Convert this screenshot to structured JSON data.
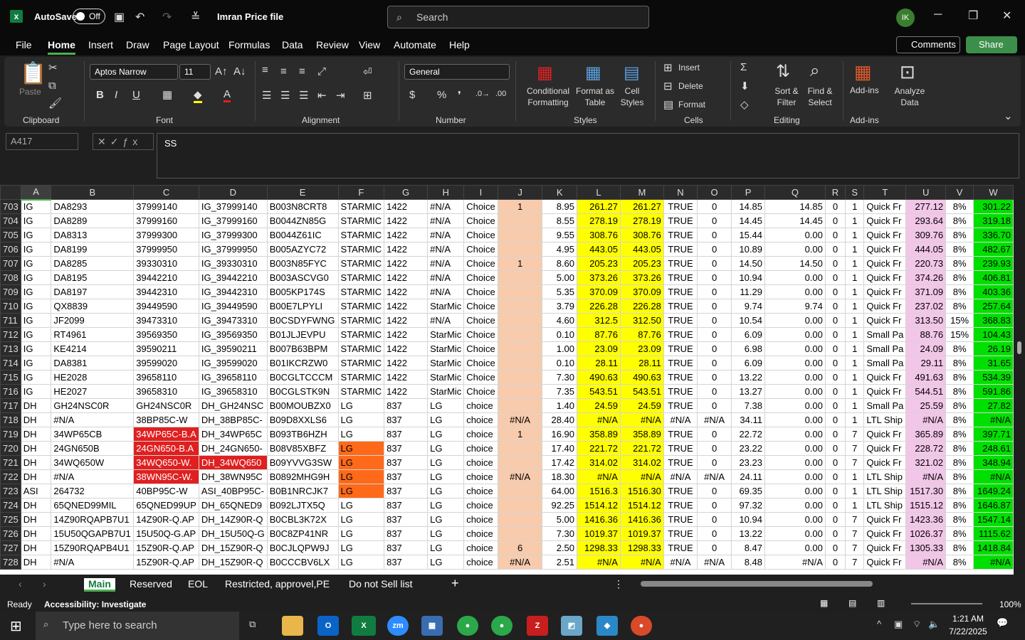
{
  "titlebar": {
    "autosave_label": "AutoSave",
    "autosave_state": "Off",
    "filename": "Imran Price file",
    "search_placeholder": "Search",
    "avatar_initials": "IK"
  },
  "menu": [
    "File",
    "Home",
    "Insert",
    "Draw",
    "Page Layout",
    "Formulas",
    "Data",
    "Review",
    "View",
    "Automate",
    "Help"
  ],
  "buttons": {
    "comments": "Comments",
    "share": "Share"
  },
  "ribbon": {
    "paste": "Paste",
    "clipboard": "Clipboard",
    "font_name": "Aptos Narrow",
    "font_size": "11",
    "font": "Font",
    "alignment": "Alignment",
    "number_format": "General",
    "number": "Number",
    "conditional_formatting": "Conditional Formatting",
    "format_as_table": "Format as Table",
    "cell_styles": "Cell Styles",
    "styles": "Styles",
    "insert": "Insert",
    "delete": "Delete",
    "format": "Format",
    "cells": "Cells",
    "sort_filter": "Sort & Filter",
    "find_select": "Find & Select",
    "editing": "Editing",
    "addins": "Add-ins",
    "addins_group": "Add-ins",
    "analyze_data": "Analyze Data"
  },
  "formula_bar": {
    "name_box": "A417",
    "formula": "SS"
  },
  "columns": [
    "A",
    "B",
    "C",
    "D",
    "E",
    "F",
    "G",
    "H",
    "I",
    "J",
    "K",
    "L",
    "M",
    "N",
    "O",
    "P",
    "Q",
    "R",
    "S",
    "T",
    "U",
    "V",
    "W"
  ],
  "rows": [
    [
      "703",
      "IG",
      "DA8293",
      "37999140",
      "IG_37999140",
      "B003N8CRT8",
      "STARMIC",
      "1422",
      "#N/A",
      "Choice",
      "1",
      "8.95",
      "261.27",
      "261.27",
      "TRUE",
      "0",
      "14.85",
      "14.85",
      "0",
      "1",
      "Quick Fr",
      "277.12",
      "8%",
      "301.22"
    ],
    [
      "704",
      "IG",
      "DA8289",
      "37999160",
      "IG_37999160",
      "B0044ZN85G",
      "STARMIC",
      "1422",
      "#N/A",
      "Choice",
      "",
      "8.55",
      "278.19",
      "278.19",
      "TRUE",
      "0",
      "14.45",
      "14.45",
      "0",
      "1",
      "Quick Fr",
      "293.64",
      "8%",
      "319.18"
    ],
    [
      "705",
      "IG",
      "DA8313",
      "37999300",
      "IG_37999300",
      "B0044Z61IC",
      "STARMIC",
      "1422",
      "#N/A",
      "Choice",
      "",
      "9.55",
      "308.76",
      "308.76",
      "TRUE",
      "0",
      "15.44",
      "0.00",
      "0",
      "1",
      "Quick Fr",
      "309.76",
      "8%",
      "336.70"
    ],
    [
      "706",
      "IG",
      "DA8199",
      "37999950",
      "IG_37999950",
      "B005AZYC72",
      "STARMIC",
      "1422",
      "#N/A",
      "Choice",
      "",
      "4.95",
      "443.05",
      "443.05",
      "TRUE",
      "0",
      "10.89",
      "0.00",
      "0",
      "1",
      "Quick Fr",
      "444.05",
      "8%",
      "482.67"
    ],
    [
      "707",
      "IG",
      "DA8285",
      "39330310",
      "IG_39330310",
      "B003N85FYC",
      "STARMIC",
      "1422",
      "#N/A",
      "Choice",
      "1",
      "8.60",
      "205.23",
      "205.23",
      "TRUE",
      "0",
      "14.50",
      "14.50",
      "0",
      "1",
      "Quick Fr",
      "220.73",
      "8%",
      "239.93"
    ],
    [
      "708",
      "IG",
      "DA8195",
      "39442210",
      "IG_39442210",
      "B003ASCVG0",
      "STARMIC",
      "1422",
      "#N/A",
      "Choice",
      "",
      "5.00",
      "373.26",
      "373.26",
      "TRUE",
      "0",
      "10.94",
      "0.00",
      "0",
      "1",
      "Quick Fr",
      "374.26",
      "8%",
      "406.81"
    ],
    [
      "709",
      "IG",
      "DA8197",
      "39442310",
      "IG_39442310",
      "B005KP174S",
      "STARMIC",
      "1422",
      "#N/A",
      "Choice",
      "",
      "5.35",
      "370.09",
      "370.09",
      "TRUE",
      "0",
      "11.29",
      "0.00",
      "0",
      "1",
      "Quick Fr",
      "371.09",
      "8%",
      "403.36"
    ],
    [
      "710",
      "IG",
      "QX8839",
      "39449590",
      "IG_39449590",
      "B00E7LPYLI",
      "STARMIC",
      "1422",
      "StarMic",
      "Choice",
      "",
      "3.79",
      "226.28",
      "226.28",
      "TRUE",
      "0",
      "9.74",
      "9.74",
      "0",
      "1",
      "Quick Fr",
      "237.02",
      "8%",
      "257.64"
    ],
    [
      "711",
      "IG",
      "JF2099",
      "39473310",
      "IG_39473310",
      "B0CSDYFWNG",
      "STARMIC",
      "1422",
      "#N/A",
      "Choice",
      "",
      "4.60",
      "312.5",
      "312.50",
      "TRUE",
      "0",
      "10.54",
      "0.00",
      "0",
      "1",
      "Quick Fr",
      "313.50",
      "15%",
      "368.83"
    ],
    [
      "712",
      "IG",
      "RT4961",
      "39569350",
      "IG_39569350",
      "B01JLJEVPU",
      "STARMIC",
      "1422",
      "StarMic",
      "Choice",
      "",
      "0.10",
      "87.76",
      "87.76",
      "TRUE",
      "0",
      "6.09",
      "0.00",
      "0",
      "1",
      "Small Pa",
      "88.76",
      "15%",
      "104.43"
    ],
    [
      "713",
      "IG",
      "KE4214",
      "39590211",
      "IG_39590211",
      "B007B63BPM",
      "STARMIC",
      "1422",
      "StarMic",
      "Choice",
      "",
      "1.00",
      "23.09",
      "23.09",
      "TRUE",
      "0",
      "6.98",
      "0.00",
      "0",
      "1",
      "Small Pa",
      "24.09",
      "8%",
      "26.19"
    ],
    [
      "714",
      "IG",
      "DA8381",
      "39599020",
      "IG_39599020",
      "B01IKCRZW0",
      "STARMIC",
      "1422",
      "StarMic",
      "Choice",
      "",
      "0.10",
      "28.11",
      "28.11",
      "TRUE",
      "0",
      "6.09",
      "0.00",
      "0",
      "1",
      "Small Pa",
      "29.11",
      "8%",
      "31.65"
    ],
    [
      "715",
      "IG",
      "HE2028",
      "39658110",
      "IG_39658110",
      "B0CGLTCCCM",
      "STARMIC",
      "1422",
      "StarMic",
      "Choice",
      "",
      "7.30",
      "490.63",
      "490.63",
      "TRUE",
      "0",
      "13.22",
      "0.00",
      "0",
      "1",
      "Quick Fr",
      "491.63",
      "8%",
      "534.39"
    ],
    [
      "716",
      "IG",
      "HE2027",
      "39658310",
      "IG_39658310",
      "B0CGLSTK9N",
      "STARMIC",
      "1422",
      "StarMic",
      "Choice",
      "",
      "7.35",
      "543.51",
      "543.51",
      "TRUE",
      "0",
      "13.27",
      "0.00",
      "0",
      "1",
      "Quick Fr",
      "544.51",
      "8%",
      "591.86"
    ],
    [
      "717",
      "DH",
      "GH24NSC0R",
      "GH24NSC0R",
      "DH_GH24NSC",
      "B00MOUBZX0",
      "LG",
      "837",
      "LG",
      "choice",
      "",
      "1.40",
      "24.59",
      "24.59",
      "TRUE",
      "0",
      "7.38",
      "0.00",
      "0",
      "1",
      "Small Pa",
      "25.59",
      "8%",
      "27.82"
    ],
    [
      "718",
      "DH",
      "#N/A",
      "38BP85C-W",
      "DH_38BP85C-",
      "B09D8XXLS6",
      "LG",
      "837",
      "LG",
      "choice",
      "#N/A",
      "28.40",
      "#N/A",
      "#N/A",
      "#N/A",
      "#N/A",
      "34.11",
      "0.00",
      "0",
      "1",
      "LTL Ship",
      "#N/A",
      "8%",
      "#N/A"
    ],
    [
      "719",
      "DH",
      "34WP65CB",
      "34WP65C-B.A",
      "DH_34WP65C",
      "B093TB6HZH",
      "LG",
      "837",
      "LG",
      "choice",
      "1",
      "16.90",
      "358.89",
      "358.89",
      "TRUE",
      "0",
      "22.72",
      "0.00",
      "0",
      "7",
      "Quick Fr",
      "365.89",
      "8%",
      "397.71"
    ],
    [
      "720",
      "DH",
      "24GN650B",
      "24GN650-B.A",
      "DH_24GN650-",
      "B08V85XBFZ",
      "LG",
      "837",
      "LG",
      "choice",
      "",
      "17.40",
      "221.72",
      "221.72",
      "TRUE",
      "0",
      "23.22",
      "0.00",
      "0",
      "7",
      "Quick Fr",
      "228.72",
      "8%",
      "248.61"
    ],
    [
      "721",
      "DH",
      "34WQ650W",
      "34WQ650-W.",
      "DH_34WQ650",
      "B09YVVG3SW",
      "LG",
      "837",
      "LG",
      "choice",
      "",
      "17.42",
      "314.02",
      "314.02",
      "TRUE",
      "0",
      "23.23",
      "0.00",
      "0",
      "7",
      "Quick Fr",
      "321.02",
      "8%",
      "348.94"
    ],
    [
      "722",
      "DH",
      "#N/A",
      "38WN95C-W.",
      "DH_38WN95C",
      "B0892MHG9H",
      "LG",
      "837",
      "LG",
      "choice",
      "#N/A",
      "18.30",
      "#N/A",
      "#N/A",
      "#N/A",
      "#N/A",
      "24.11",
      "0.00",
      "0",
      "1",
      "LTL Ship",
      "#N/A",
      "8%",
      "#N/A"
    ],
    [
      "723",
      "ASI",
      "264732",
      "40BP95C-W",
      "ASI_40BP95C-",
      "B0B1NRCJK7",
      "LG",
      "837",
      "LG",
      "choice",
      "",
      "64.00",
      "1516.3",
      "1516.30",
      "TRUE",
      "0",
      "69.35",
      "0.00",
      "0",
      "1",
      "LTL Ship",
      "1517.30",
      "8%",
      "1649.24"
    ],
    [
      "724",
      "DH",
      "65QNED99MIL",
      "65QNED99UP",
      "DH_65QNED9",
      "B092LJTX5Q",
      "LG",
      "837",
      "LG",
      "choice",
      "",
      "92.25",
      "1514.12",
      "1514.12",
      "TRUE",
      "0",
      "97.32",
      "0.00",
      "0",
      "1",
      "LTL Ship",
      "1515.12",
      "8%",
      "1646.87"
    ],
    [
      "725",
      "DH",
      "14Z90RQAPB7U1",
      "14Z90R-Q.AP",
      "DH_14Z90R-Q",
      "B0CBL3K72X",
      "LG",
      "837",
      "LG",
      "choice",
      "",
      "5.00",
      "1416.36",
      "1416.36",
      "TRUE",
      "0",
      "10.94",
      "0.00",
      "0",
      "7",
      "Quick Fr",
      "1423.36",
      "8%",
      "1547.14"
    ],
    [
      "726",
      "DH",
      "15U50QGAPB7U1",
      "15U50Q-G.AP",
      "DH_15U50Q-G",
      "B0C8ZP41NR",
      "LG",
      "837",
      "LG",
      "choice",
      "",
      "7.30",
      "1019.37",
      "1019.37",
      "TRUE",
      "0",
      "13.22",
      "0.00",
      "0",
      "7",
      "Quick Fr",
      "1026.37",
      "8%",
      "1115.62"
    ],
    [
      "727",
      "DH",
      "15Z90RQAPB4U1",
      "15Z90R-Q.AP",
      "DH_15Z90R-Q",
      "B0CJLQPW9J",
      "LG",
      "837",
      "LG",
      "choice",
      "6",
      "2.50",
      "1298.33",
      "1298.33",
      "TRUE",
      "0",
      "8.47",
      "0.00",
      "0",
      "7",
      "Quick Fr",
      "1305.33",
      "8%",
      "1418.84"
    ],
    [
      "728",
      "DH",
      "#N/A",
      "15Z90R-Q.AP",
      "DH_15Z90R-Q",
      "B0CCCBV6LX",
      "LG",
      "837",
      "LG",
      "choice",
      "#N/A",
      "2.51",
      "#N/A",
      "#N/A",
      "#N/A",
      "#N/A",
      "8.48",
      "#N/A",
      "0",
      "7",
      "Quick Fr",
      "#N/A",
      "8%",
      "#N/A"
    ]
  ],
  "sheet_tabs": [
    "Main",
    "Reserved",
    "EOL",
    "Restricted, approvel,PE",
    "Do not Sell list"
  ],
  "status": {
    "ready": "Ready",
    "accessibility": "Accessibility: Investigate",
    "zoom": "100%"
  },
  "taskbar": {
    "search_placeholder": "Type here to search",
    "time": "1:21 AM",
    "date": "7/22/2025"
  },
  "colors": {
    "excel_green": "#107c41",
    "yellow_fill": "#ffff00",
    "peach_fill": "#f8cbad",
    "pink_fill": "#f2c6e8",
    "green_fill": "#00e000",
    "red_fill": "#e02020",
    "orange_fill": "#ff6a1a"
  }
}
